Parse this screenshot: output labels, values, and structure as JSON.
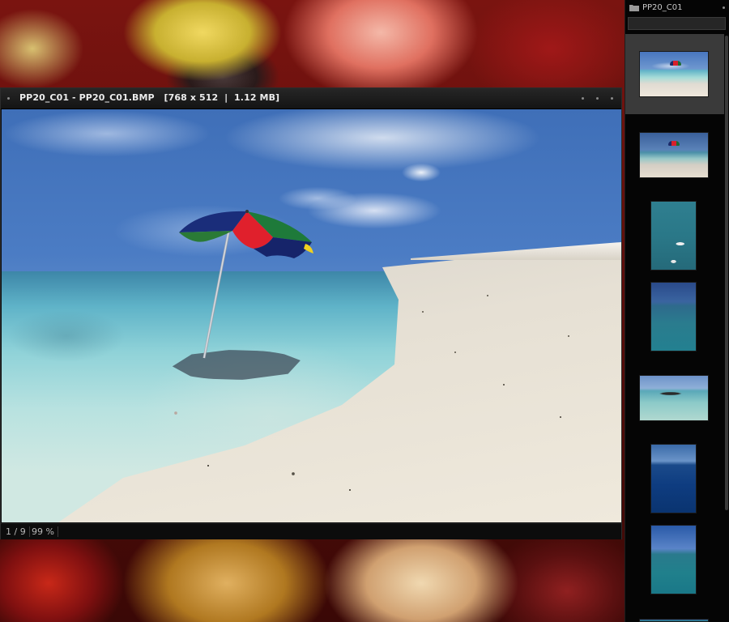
{
  "viewer": {
    "title": "PP20_C01 - PP20_C01.BMP   [768 x 512  |  1.12 MB]",
    "status": {
      "position": "1 / 9",
      "zoom": "99 %"
    }
  },
  "panel": {
    "folder_name": "PP20_C01",
    "filter_value": "",
    "thumbnails": [
      {
        "type": "beach",
        "selected": true
      },
      {
        "type": "beach",
        "selected": false
      },
      {
        "type": "boats",
        "selected": false
      },
      {
        "type": "ocean",
        "selected": false
      },
      {
        "type": "swimmer",
        "selected": false
      },
      {
        "type": "deep-water",
        "selected": false
      },
      {
        "type": "calm-sea",
        "selected": false
      }
    ]
  },
  "colors": {
    "window_bg": "#0c0c0c",
    "titlebar": "#1a1a1a",
    "selected_thumb": "#3a3a3a",
    "text": "#ececec"
  },
  "icons": {
    "folder": "folder-icon",
    "window_menu": "dot-icon"
  }
}
